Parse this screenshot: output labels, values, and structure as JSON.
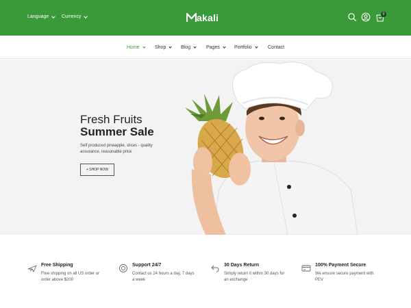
{
  "header": {
    "language_label": "Language",
    "currency_label": "Currency",
    "brand": "akali",
    "brand_initial": "M",
    "cart_count": "0",
    "icons": [
      "search-icon",
      "user-icon",
      "cart-icon"
    ],
    "background": "#3a9a3a"
  },
  "nav": {
    "items": [
      {
        "label": "Home",
        "active": true
      },
      {
        "label": "Shop"
      },
      {
        "label": "Blog"
      },
      {
        "label": "Pages"
      },
      {
        "label": "Portfolio"
      },
      {
        "label": "Contact"
      }
    ],
    "accent": "#3a9a3a"
  },
  "hero": {
    "title_line1": "Fresh Fruits",
    "title_line2": "Summer Sale",
    "description": "Self produced pineapple, slices - quality assurance, reasonable price",
    "cta_label": "+ SHOP NOW"
  },
  "features": [
    {
      "icon": "airplane-icon",
      "title": "Free Shipping",
      "text": "Free shipping on all US order or order above $200"
    },
    {
      "icon": "support-icon",
      "title": "Support 24/7",
      "text": "Contact us 24 hours a day, 7 days a week"
    },
    {
      "icon": "return-icon",
      "title": "30 Days Return",
      "text": "Simply return it within 30 days for an exchange"
    },
    {
      "icon": "payment-card-icon",
      "title": "100% Payment Secure",
      "text": "We ensure secure payment with PEV"
    }
  ]
}
